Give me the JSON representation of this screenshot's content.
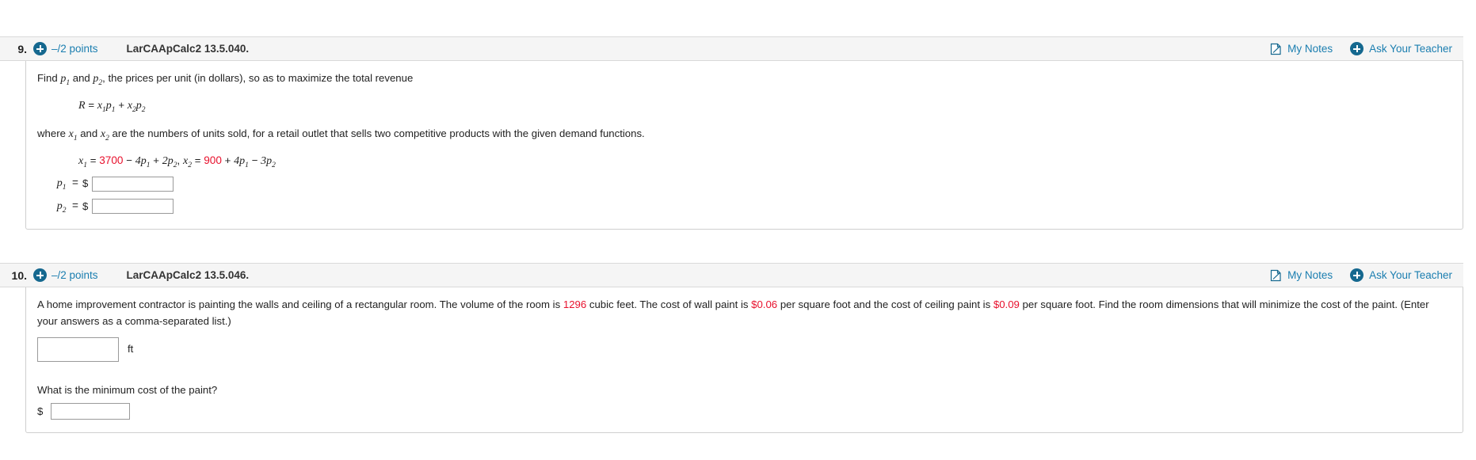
{
  "questions": [
    {
      "number": "9.",
      "points": "–/2 points",
      "code": "LarCAApCalc2 13.5.040.",
      "my_notes": "My Notes",
      "ask_teacher": "Ask Your Teacher",
      "prompt_pre": "Find ",
      "prompt_mid": " and ",
      "prompt_post": ", the prices per unit (in dollars), so as to maximize the total revenue",
      "var_p1": "p",
      "var_p1_sub": "1",
      "var_p2": "p",
      "var_p2_sub": "2",
      "revenue_eq": "R = x₁p₁ + x₂p₂",
      "where_text_a": "where ",
      "where_text_b": " and ",
      "where_text_c": " are the numbers of units sold, for a retail outlet that sells two competitive products with the given demand functions.",
      "var_x1": "x",
      "var_x2": "x",
      "demand_x1_const": "3700",
      "demand_x2_const": "900",
      "answers": [
        {
          "label_var": "p",
          "label_sub": "1",
          "label_eq": "=",
          "dollar": "$",
          "value": "",
          "placeholder": ""
        },
        {
          "label_var": "p",
          "label_sub": "2",
          "label_eq": "=",
          "dollar": "$",
          "value": "",
          "placeholder": ""
        }
      ]
    },
    {
      "number": "10.",
      "points": "–/2 points",
      "code": "LarCAApCalc2 13.5.046.",
      "my_notes": "My Notes",
      "ask_teacher": "Ask Your Teacher",
      "body_a": "A home improvement contractor is painting the walls and ceiling of a rectangular room. The volume of the room is ",
      "volume": "1296",
      "body_b": " cubic feet. The cost of wall paint is ",
      "wall_cost": "$0.06",
      "body_c": " per square foot and the cost of ceiling paint is ",
      "ceiling_cost": "$0.09",
      "body_d": " per square foot. Find the room dimensions that will minimize the cost of the paint. (Enter your answers as a comma-separated list.)",
      "dimension_value": "",
      "unit": "ft",
      "subquestion": "What is the minimum cost of the paint?",
      "dollar": "$",
      "cost_value": ""
    }
  ],
  "colors": {
    "accent_blue": "#1b7eb0",
    "icon_blue": "#15688f",
    "highlight_red": "#e8112d",
    "header_bg": "#f5f5f5",
    "border": "#cfcfcf"
  }
}
